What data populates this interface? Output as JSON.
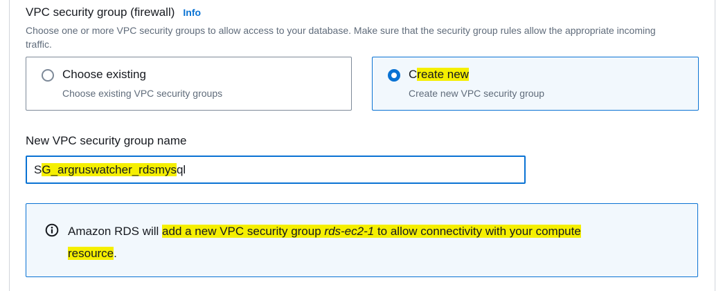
{
  "section": {
    "title": "VPC security group (firewall)",
    "info_link": "Info",
    "description": "Choose one or more VPC security groups to allow access to your database. Make sure that the security group rules allow the appropriate incoming traffic."
  },
  "options": {
    "existing": {
      "label": "Choose existing",
      "description": "Choose existing VPC security groups",
      "selected": false
    },
    "new": {
      "label_first": "C",
      "label_rest": "reate new",
      "description": "Create new VPC security group",
      "selected": true
    }
  },
  "name_field": {
    "label": "New VPC security group name",
    "value_prefix": "S",
    "value_mid": "G_argruswatcher_rdsmys",
    "value_suffix": "ql"
  },
  "alert": {
    "icon": "info-circle-icon",
    "text_plain": "Amazon RDS will ",
    "text_hl_1": "add a new VPC security group ",
    "text_hl_italic": "rds-ec2-1",
    "text_hl_2": " to allow connectivity with your compute",
    "text_hl_3": "resource",
    "text_end": "."
  },
  "colors": {
    "accent": "#0972d3",
    "highlight": "#f5ef00",
    "selected_tile_bg": "#f2f8fd",
    "secondary_text": "#5f6b7a"
  }
}
